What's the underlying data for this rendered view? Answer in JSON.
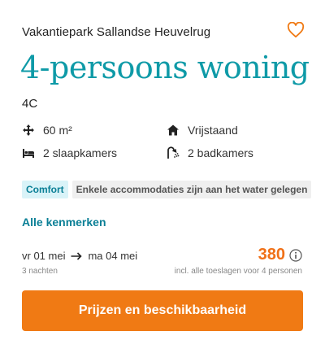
{
  "header": {
    "park_name": "Vakantiepark Sallandse Heuvelrug",
    "favorite_icon": "heart-outline-icon"
  },
  "accommodation": {
    "title": "4-persoons woning",
    "code": "4C"
  },
  "features": [
    {
      "icon": "move-arrows-icon",
      "label": "60 m²"
    },
    {
      "icon": "house-icon",
      "label": "Vrijstaand"
    },
    {
      "icon": "bed-icon",
      "label": "2 slaapkamers"
    },
    {
      "icon": "shower-icon",
      "label": "2 badkamers"
    }
  ],
  "badges": {
    "comfort": "Comfort",
    "note": "Enkele accommodaties zijn aan het water gelegen"
  },
  "links": {
    "all_features": "Alle kenmerken"
  },
  "stay": {
    "from": "vr 01 mei",
    "to": "ma 04 mei",
    "nights": "3 nachten"
  },
  "price": {
    "amount": "380",
    "note": "incl. alle toeslagen voor 4 personen"
  },
  "cta": {
    "label": "Prijzen en beschikbaarheid"
  },
  "colors": {
    "title": "#0e9aa7",
    "accent_orange": "#f07a14",
    "price": "#f07017",
    "link": "#0a7f96"
  }
}
